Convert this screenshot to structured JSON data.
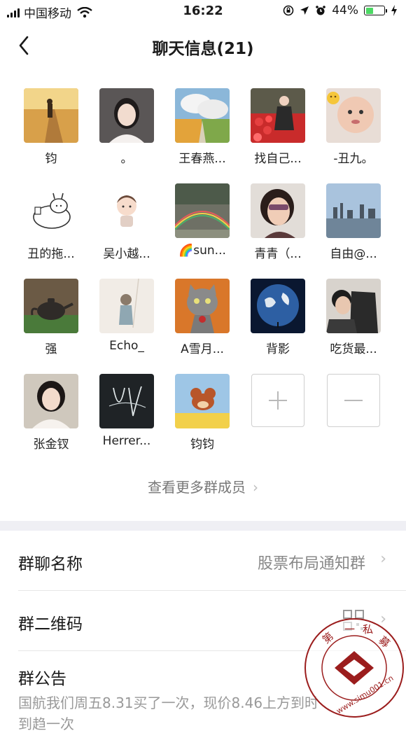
{
  "status_bar": {
    "carrier": "中国移动",
    "time": "16:22",
    "battery": "44%",
    "battery_level": 0.44
  },
  "nav": {
    "title": "聊天信息(21)",
    "back_icon": "chevron-left-icon"
  },
  "members": [
    {
      "name": "钧",
      "avatar": "road-walker"
    },
    {
      "name": "。",
      "avatar": "woman-portrait"
    },
    {
      "name": "王春燕...",
      "avatar": "clouds-field"
    },
    {
      "name": "找自己...",
      "avatar": "flowers-woman"
    },
    {
      "name": "-丑九。",
      "avatar": "baby-face"
    },
    {
      "name": "丑的拖...",
      "avatar": "cartoon-rabbit"
    },
    {
      "name": "吴小越...",
      "avatar": "cartoon-girl"
    },
    {
      "name": "🌈sun...",
      "avatar": "rainbow-waterfall"
    },
    {
      "name": "青青（...",
      "avatar": "woman-sunglasses"
    },
    {
      "name": "自由@...",
      "avatar": "city-skyline"
    },
    {
      "name": "强",
      "avatar": "teapot"
    },
    {
      "name": "Echo_",
      "avatar": "sketch-girl"
    },
    {
      "name": "A雪月...",
      "avatar": "cat-flower"
    },
    {
      "name": "背影",
      "avatar": "earth"
    },
    {
      "name": "吃货最...",
      "avatar": "haircut"
    },
    {
      "name": "张金钗",
      "avatar": "woman-car"
    },
    {
      "name": "Herrer...",
      "avatar": "signature-art"
    },
    {
      "name": "钧钧",
      "avatar": "cartoon-mouse"
    }
  ],
  "actions": {
    "add_icon": "plus-icon",
    "remove_icon": "minus-icon"
  },
  "more_members": "查看更多群成员",
  "settings": {
    "group_name_label": "群聊名称",
    "group_name_value": "股票布局通知群",
    "qrcode_label": "群二维码",
    "qrcode_icon": "qrcode-icon",
    "announcement_label": "群公告",
    "announcement_text": "国航我们周五8.31买了一次，现价8.46上方到时",
    "announcement_text_2": "到趋一次"
  },
  "watermark": {
    "text": "第一私募",
    "url": "www.simu001.cn"
  },
  "colors": {
    "battery_fill": "#4cd964",
    "band": "#efeff4",
    "secondary_text": "#888888",
    "watermark": "#9b1d1d"
  }
}
